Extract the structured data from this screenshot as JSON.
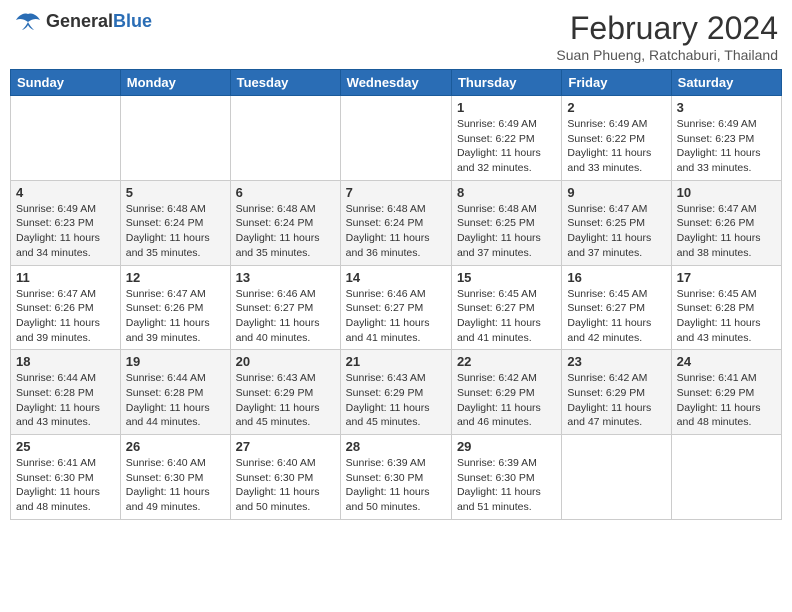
{
  "logo": {
    "general": "General",
    "blue": "Blue"
  },
  "title": "February 2024",
  "subtitle": "Suan Phueng, Ratchaburi, Thailand",
  "weekdays": [
    "Sunday",
    "Monday",
    "Tuesday",
    "Wednesday",
    "Thursday",
    "Friday",
    "Saturday"
  ],
  "weeks": [
    [
      {
        "day": "",
        "info": ""
      },
      {
        "day": "",
        "info": ""
      },
      {
        "day": "",
        "info": ""
      },
      {
        "day": "",
        "info": ""
      },
      {
        "day": "1",
        "info": "Sunrise: 6:49 AM\nSunset: 6:22 PM\nDaylight: 11 hours and 32 minutes."
      },
      {
        "day": "2",
        "info": "Sunrise: 6:49 AM\nSunset: 6:22 PM\nDaylight: 11 hours and 33 minutes."
      },
      {
        "day": "3",
        "info": "Sunrise: 6:49 AM\nSunset: 6:23 PM\nDaylight: 11 hours and 33 minutes."
      }
    ],
    [
      {
        "day": "4",
        "info": "Sunrise: 6:49 AM\nSunset: 6:23 PM\nDaylight: 11 hours and 34 minutes."
      },
      {
        "day": "5",
        "info": "Sunrise: 6:48 AM\nSunset: 6:24 PM\nDaylight: 11 hours and 35 minutes."
      },
      {
        "day": "6",
        "info": "Sunrise: 6:48 AM\nSunset: 6:24 PM\nDaylight: 11 hours and 35 minutes."
      },
      {
        "day": "7",
        "info": "Sunrise: 6:48 AM\nSunset: 6:24 PM\nDaylight: 11 hours and 36 minutes."
      },
      {
        "day": "8",
        "info": "Sunrise: 6:48 AM\nSunset: 6:25 PM\nDaylight: 11 hours and 37 minutes."
      },
      {
        "day": "9",
        "info": "Sunrise: 6:47 AM\nSunset: 6:25 PM\nDaylight: 11 hours and 37 minutes."
      },
      {
        "day": "10",
        "info": "Sunrise: 6:47 AM\nSunset: 6:26 PM\nDaylight: 11 hours and 38 minutes."
      }
    ],
    [
      {
        "day": "11",
        "info": "Sunrise: 6:47 AM\nSunset: 6:26 PM\nDaylight: 11 hours and 39 minutes."
      },
      {
        "day": "12",
        "info": "Sunrise: 6:47 AM\nSunset: 6:26 PM\nDaylight: 11 hours and 39 minutes."
      },
      {
        "day": "13",
        "info": "Sunrise: 6:46 AM\nSunset: 6:27 PM\nDaylight: 11 hours and 40 minutes."
      },
      {
        "day": "14",
        "info": "Sunrise: 6:46 AM\nSunset: 6:27 PM\nDaylight: 11 hours and 41 minutes."
      },
      {
        "day": "15",
        "info": "Sunrise: 6:45 AM\nSunset: 6:27 PM\nDaylight: 11 hours and 41 minutes."
      },
      {
        "day": "16",
        "info": "Sunrise: 6:45 AM\nSunset: 6:27 PM\nDaylight: 11 hours and 42 minutes."
      },
      {
        "day": "17",
        "info": "Sunrise: 6:45 AM\nSunset: 6:28 PM\nDaylight: 11 hours and 43 minutes."
      }
    ],
    [
      {
        "day": "18",
        "info": "Sunrise: 6:44 AM\nSunset: 6:28 PM\nDaylight: 11 hours and 43 minutes."
      },
      {
        "day": "19",
        "info": "Sunrise: 6:44 AM\nSunset: 6:28 PM\nDaylight: 11 hours and 44 minutes."
      },
      {
        "day": "20",
        "info": "Sunrise: 6:43 AM\nSunset: 6:29 PM\nDaylight: 11 hours and 45 minutes."
      },
      {
        "day": "21",
        "info": "Sunrise: 6:43 AM\nSunset: 6:29 PM\nDaylight: 11 hours and 45 minutes."
      },
      {
        "day": "22",
        "info": "Sunrise: 6:42 AM\nSunset: 6:29 PM\nDaylight: 11 hours and 46 minutes."
      },
      {
        "day": "23",
        "info": "Sunrise: 6:42 AM\nSunset: 6:29 PM\nDaylight: 11 hours and 47 minutes."
      },
      {
        "day": "24",
        "info": "Sunrise: 6:41 AM\nSunset: 6:29 PM\nDaylight: 11 hours and 48 minutes."
      }
    ],
    [
      {
        "day": "25",
        "info": "Sunrise: 6:41 AM\nSunset: 6:30 PM\nDaylight: 11 hours and 48 minutes."
      },
      {
        "day": "26",
        "info": "Sunrise: 6:40 AM\nSunset: 6:30 PM\nDaylight: 11 hours and 49 minutes."
      },
      {
        "day": "27",
        "info": "Sunrise: 6:40 AM\nSunset: 6:30 PM\nDaylight: 11 hours and 50 minutes."
      },
      {
        "day": "28",
        "info": "Sunrise: 6:39 AM\nSunset: 6:30 PM\nDaylight: 11 hours and 50 minutes."
      },
      {
        "day": "29",
        "info": "Sunrise: 6:39 AM\nSunset: 6:30 PM\nDaylight: 11 hours and 51 minutes."
      },
      {
        "day": "",
        "info": ""
      },
      {
        "day": "",
        "info": ""
      }
    ]
  ]
}
